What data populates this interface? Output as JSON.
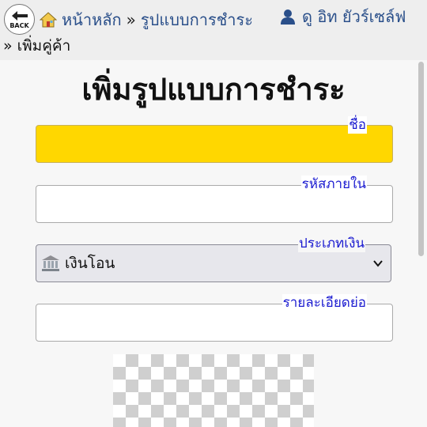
{
  "header": {
    "back_label": "BACK",
    "home_link": "หน้าหลัก",
    "separator": "»",
    "current_link": "รูปแบบการชำระ",
    "user_name": "ดู อิท ยัวร์เซล์ฟ",
    "sub_breadcrumb": "» เพิ่มคู่ค้า"
  },
  "page": {
    "title": "เพิ่มรูปแบบการชำระ"
  },
  "form": {
    "name_label": "ชื่อ",
    "name_value": "",
    "code_label": "รหัสภายใน",
    "code_value": "",
    "type_label": "ประเภทเงิน",
    "type_value": "เงินโอน",
    "type_icon": "bank-icon",
    "detail_label": "รายละเอียดย่อ",
    "detail_value": ""
  },
  "colors": {
    "name_field_bg": "#ffd700",
    "label_color": "#1a1ad0",
    "link_color": "#2a4f8a"
  }
}
